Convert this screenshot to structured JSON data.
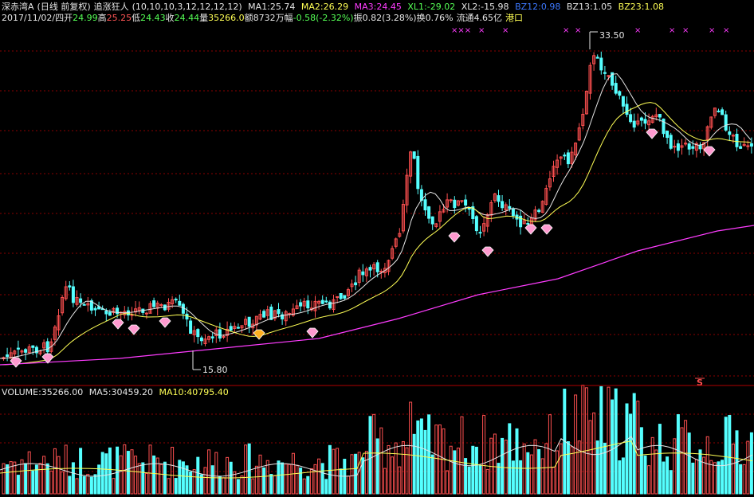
{
  "header": {
    "stock_name": "深赤湾A",
    "period_label": "(日线 前复权)",
    "indicator_name": "追涨狂人",
    "indicator_params": "(10,10,10,3,12,12,12,12)",
    "ma1": {
      "label": "MA1:",
      "value": "25.74",
      "color": "#e6e6e6"
    },
    "ma2": {
      "label": "MA2:",
      "value": "26.29",
      "color": "#ffff55"
    },
    "ma3": {
      "label": "MA3:",
      "value": "24.45",
      "color": "#ff3cff"
    },
    "xl1": {
      "label": "XL1:",
      "value": "-29.02",
      "color": "#55ff55"
    },
    "xl2": {
      "label": "XL2:",
      "value": "-15.98",
      "color": "#e6e6e6"
    },
    "bz12": {
      "label": "BZ12:",
      "value": "0.98",
      "color": "#3c78ff"
    },
    "bz13": {
      "label": "BZ13:",
      "value": "1.05",
      "color": "#e6e6e6"
    },
    "bz23": {
      "label": "BZ23:",
      "value": "1.08",
      "color": "#ffff55"
    }
  },
  "quote": {
    "date": "2017/11/02/四",
    "open_label": "开",
    "open": "24.99",
    "high_label": "高",
    "high": "25.25",
    "low_label": "低",
    "low": "24.43",
    "close_label": "收",
    "close": "24.44",
    "volume_label": "量",
    "volume": "35266.0",
    "amount_label": "额",
    "amount": "8732万",
    "change_label": "幅",
    "change": "-0.58(-2.32%)",
    "amplitude_label": "振",
    "amplitude": "0.82(3.28%)",
    "turnover_label": "换",
    "turnover": "0.76%",
    "float_label": "流通",
    "float_value": "4.65亿",
    "sector": "港口"
  },
  "annotations": {
    "max_price": "33.50",
    "min_price": "15.80",
    "marker_symbol": "×",
    "triple_marker": "×××",
    "s_marker": "S"
  },
  "volume_panel": {
    "volume": {
      "label": "VOLUME:",
      "value": "35266.00"
    },
    "ma5": {
      "label": "MA5:",
      "value": "30459.20"
    },
    "ma10": {
      "label": "MA10:",
      "value": "40795.40"
    }
  },
  "colors": {
    "background": "#000000",
    "up_candle": "#ff5050",
    "down_candle": "#55ffff",
    "grid": "#8b0000",
    "ma1_line": "#e6e6e6",
    "ma2_line": "#ffff55",
    "ma3_line": "#ff3cff"
  }
}
